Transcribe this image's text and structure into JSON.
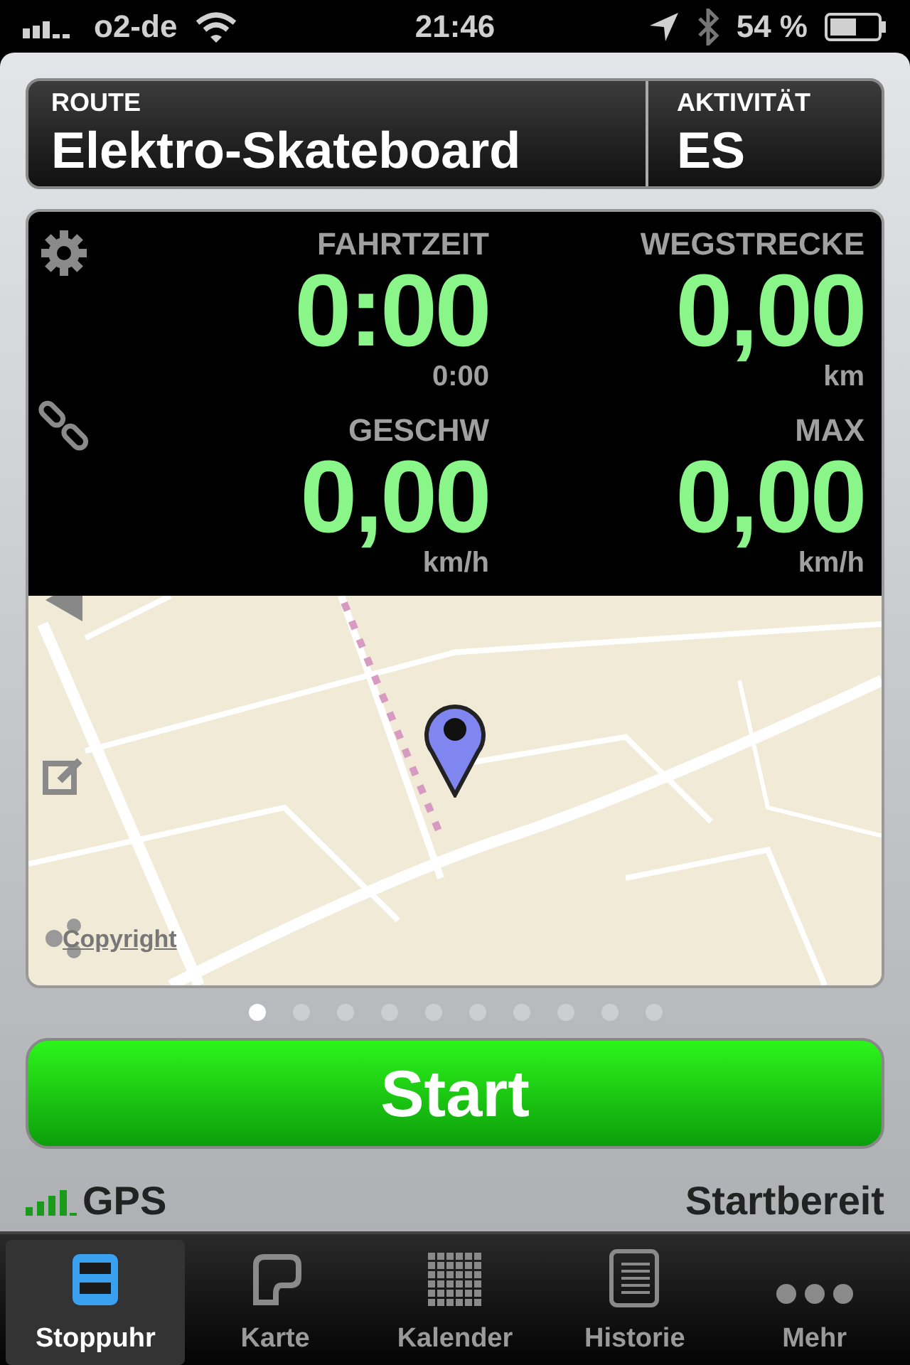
{
  "status_bar": {
    "carrier": "o2-de",
    "time": "21:46",
    "battery": "54 %"
  },
  "header": {
    "route_label": "ROUTE",
    "route": "Elektro-Skateboard",
    "activity_label": "AKTIVITÄT",
    "activity": "ES"
  },
  "stats": [
    {
      "label": "FAHRTZEIT",
      "value": "0:00",
      "sub": "0:00"
    },
    {
      "label": "WEGSTRECKE",
      "value": "0,00",
      "sub": "km"
    },
    {
      "label": "GESCHW",
      "value": "0,00",
      "sub": "km/h"
    },
    {
      "label": "MAX",
      "value": "0,00",
      "sub": "km/h"
    }
  ],
  "map": {
    "kind": "picture",
    "copyright": "Copyright"
  },
  "page_dots": [
    {
      "selected": true
    },
    {
      "selected": false
    },
    {
      "selected": false
    },
    {
      "selected": false
    },
    {
      "selected": false
    },
    {
      "selected": false
    },
    {
      "selected": false
    },
    {
      "selected": false
    },
    {
      "selected": false
    },
    {
      "selected": false
    }
  ],
  "start_button": "Start",
  "footer": {
    "gps": "GPS",
    "status": "Startbereit"
  },
  "tabs": [
    {
      "label": "Stoppuhr",
      "kind": "stopwatch",
      "selected": true
    },
    {
      "label": "Karte",
      "kind": "map",
      "selected": false
    },
    {
      "label": "Kalender",
      "kind": "calendar",
      "selected": false
    },
    {
      "label": "Historie",
      "kind": "history",
      "selected": false
    },
    {
      "label": "Mehr",
      "kind": "more",
      "selected": false
    }
  ]
}
